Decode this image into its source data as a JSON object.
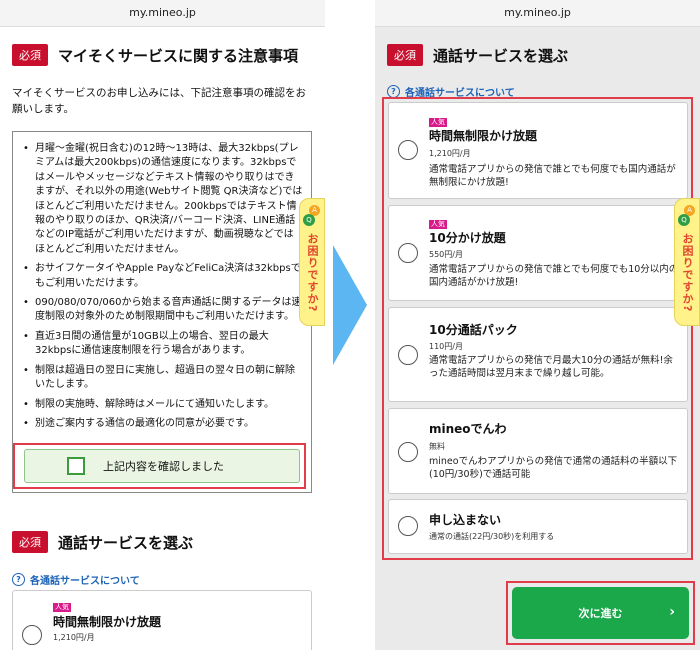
{
  "url": "my.mineo.jp",
  "required_badge": "必須",
  "left": {
    "section_title": "マイそくサービスに関する注意事項",
    "intro": "マイそくサービスのお申し込みには、下記注意事項の確認をお願いします。",
    "notices": [
      "月曜〜金曜(祝日含む)の12時〜13時は、最大32kbps(プレミアムは最大200kbps)の通信速度になります。32kbpsではメールやメッセージなどテキスト情報のやり取りはできますが、それ以外の用途(Webサイト閲覧 QR決済など)ではほとんどご利用いただけません。200kbpsではテキスト情報のやり取りのほか、QR決済/バーコード決済、LINE通話などのIP電話がご利用いただけますが、動画視聴などではほとんどご利用いただけません。",
      "おサイフケータイやApple PayなどFeliCa決済は32kbpsでもご利用いただけます。",
      "090/080/070/060から始まる音声通話に関するデータは速度制限の対象外のため制限期間中もご利用いただけます。",
      "直近3日間の通信量が10GB以上の場合、翌日の最大32kbpsに通信速度制限を行う場合があります。",
      "制限は超過日の翌日に実施し、超過日の翌々日の朝に解除いたします。",
      "制限の実施時、解除時はメールにて通知いたします。",
      "別途ご案内する通信の最適化の同意が必要です。"
    ],
    "confirm_label": "上記内容を確認しました",
    "section2_title": "通話サービスを選ぶ",
    "help_link": "各通話サービスについて",
    "preview_option": {
      "popular": "人気",
      "name": "時間無制限かけ放題",
      "price": "1,210円/月"
    }
  },
  "float_help": {
    "a_icon": "A",
    "q_icon": "Q",
    "text": "お困りですか?"
  },
  "right": {
    "section_title": "通話サービスを選ぶ",
    "help_link": "各通話サービスについて",
    "options": [
      {
        "popular": "人気",
        "name": "時間無制限かけ放題",
        "price": "1,210円/月",
        "desc": "通常電話アプリからの発信で誰とでも何度でも国内通話が無制限にかけ放題!"
      },
      {
        "popular": "人気",
        "name": "10分かけ放題",
        "price": "550円/月",
        "desc": "通常電話アプリからの発信で誰とでも何度でも10分以内の国内通話がかけ放題!"
      },
      {
        "popular": "",
        "name": "10分通話パック",
        "price": "110円/月",
        "desc": "通常電話アプリからの発信で月最大10分の通話が無料!余った通話時間は翌月末まで繰り越し可能。"
      },
      {
        "popular": "",
        "name": "mineoでんわ",
        "price": "無料",
        "desc": "mineoでんわアプリからの発信で通常の通話料の半額以下(10円/30秒)で通話可能"
      },
      {
        "popular": "",
        "name": "申し込まない",
        "price": "通常の通話(22円/30秒)を利用する",
        "desc": ""
      }
    ],
    "next_button": "次に進む",
    "next_chevron": "›"
  },
  "colors": {
    "required": "#c8102e",
    "highlight": "#e23b4a",
    "green": "#1aa84b",
    "link": "#1c63b8",
    "arrow": "#5bb6f2"
  }
}
